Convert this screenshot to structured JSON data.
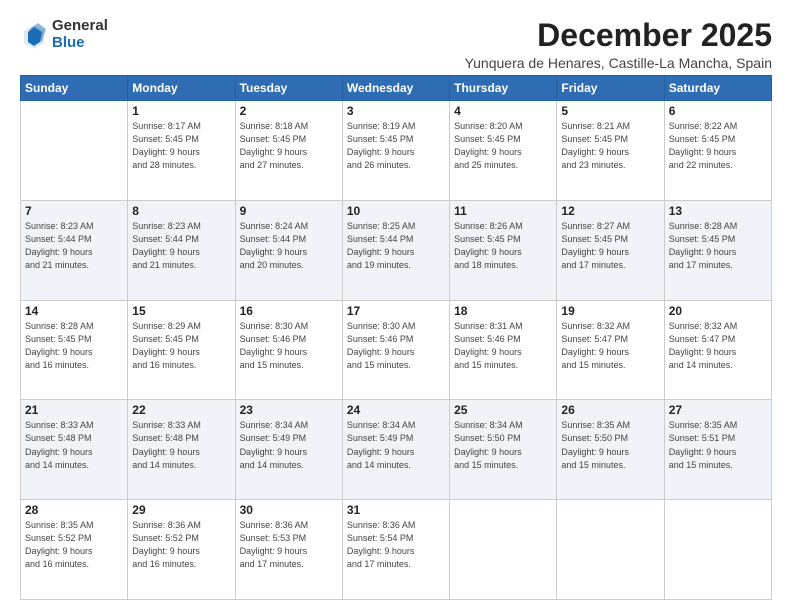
{
  "logo": {
    "general": "General",
    "blue": "Blue"
  },
  "title": "December 2025",
  "location": "Yunquera de Henares, Castille-La Mancha, Spain",
  "days_of_week": [
    "Sunday",
    "Monday",
    "Tuesday",
    "Wednesday",
    "Thursday",
    "Friday",
    "Saturday"
  ],
  "weeks": [
    [
      {
        "day": "",
        "info": ""
      },
      {
        "day": "1",
        "info": "Sunrise: 8:17 AM\nSunset: 5:45 PM\nDaylight: 9 hours\nand 28 minutes."
      },
      {
        "day": "2",
        "info": "Sunrise: 8:18 AM\nSunset: 5:45 PM\nDaylight: 9 hours\nand 27 minutes."
      },
      {
        "day": "3",
        "info": "Sunrise: 8:19 AM\nSunset: 5:45 PM\nDaylight: 9 hours\nand 26 minutes."
      },
      {
        "day": "4",
        "info": "Sunrise: 8:20 AM\nSunset: 5:45 PM\nDaylight: 9 hours\nand 25 minutes."
      },
      {
        "day": "5",
        "info": "Sunrise: 8:21 AM\nSunset: 5:45 PM\nDaylight: 9 hours\nand 23 minutes."
      },
      {
        "day": "6",
        "info": "Sunrise: 8:22 AM\nSunset: 5:45 PM\nDaylight: 9 hours\nand 22 minutes."
      }
    ],
    [
      {
        "day": "7",
        "info": "Sunrise: 8:23 AM\nSunset: 5:44 PM\nDaylight: 9 hours\nand 21 minutes."
      },
      {
        "day": "8",
        "info": "Sunrise: 8:23 AM\nSunset: 5:44 PM\nDaylight: 9 hours\nand 21 minutes."
      },
      {
        "day": "9",
        "info": "Sunrise: 8:24 AM\nSunset: 5:44 PM\nDaylight: 9 hours\nand 20 minutes."
      },
      {
        "day": "10",
        "info": "Sunrise: 8:25 AM\nSunset: 5:44 PM\nDaylight: 9 hours\nand 19 minutes."
      },
      {
        "day": "11",
        "info": "Sunrise: 8:26 AM\nSunset: 5:45 PM\nDaylight: 9 hours\nand 18 minutes."
      },
      {
        "day": "12",
        "info": "Sunrise: 8:27 AM\nSunset: 5:45 PM\nDaylight: 9 hours\nand 17 minutes."
      },
      {
        "day": "13",
        "info": "Sunrise: 8:28 AM\nSunset: 5:45 PM\nDaylight: 9 hours\nand 17 minutes."
      }
    ],
    [
      {
        "day": "14",
        "info": "Sunrise: 8:28 AM\nSunset: 5:45 PM\nDaylight: 9 hours\nand 16 minutes."
      },
      {
        "day": "15",
        "info": "Sunrise: 8:29 AM\nSunset: 5:45 PM\nDaylight: 9 hours\nand 16 minutes."
      },
      {
        "day": "16",
        "info": "Sunrise: 8:30 AM\nSunset: 5:46 PM\nDaylight: 9 hours\nand 15 minutes."
      },
      {
        "day": "17",
        "info": "Sunrise: 8:30 AM\nSunset: 5:46 PM\nDaylight: 9 hours\nand 15 minutes."
      },
      {
        "day": "18",
        "info": "Sunrise: 8:31 AM\nSunset: 5:46 PM\nDaylight: 9 hours\nand 15 minutes."
      },
      {
        "day": "19",
        "info": "Sunrise: 8:32 AM\nSunset: 5:47 PM\nDaylight: 9 hours\nand 15 minutes."
      },
      {
        "day": "20",
        "info": "Sunrise: 8:32 AM\nSunset: 5:47 PM\nDaylight: 9 hours\nand 14 minutes."
      }
    ],
    [
      {
        "day": "21",
        "info": "Sunrise: 8:33 AM\nSunset: 5:48 PM\nDaylight: 9 hours\nand 14 minutes."
      },
      {
        "day": "22",
        "info": "Sunrise: 8:33 AM\nSunset: 5:48 PM\nDaylight: 9 hours\nand 14 minutes."
      },
      {
        "day": "23",
        "info": "Sunrise: 8:34 AM\nSunset: 5:49 PM\nDaylight: 9 hours\nand 14 minutes."
      },
      {
        "day": "24",
        "info": "Sunrise: 8:34 AM\nSunset: 5:49 PM\nDaylight: 9 hours\nand 14 minutes."
      },
      {
        "day": "25",
        "info": "Sunrise: 8:34 AM\nSunset: 5:50 PM\nDaylight: 9 hours\nand 15 minutes."
      },
      {
        "day": "26",
        "info": "Sunrise: 8:35 AM\nSunset: 5:50 PM\nDaylight: 9 hours\nand 15 minutes."
      },
      {
        "day": "27",
        "info": "Sunrise: 8:35 AM\nSunset: 5:51 PM\nDaylight: 9 hours\nand 15 minutes."
      }
    ],
    [
      {
        "day": "28",
        "info": "Sunrise: 8:35 AM\nSunset: 5:52 PM\nDaylight: 9 hours\nand 16 minutes."
      },
      {
        "day": "29",
        "info": "Sunrise: 8:36 AM\nSunset: 5:52 PM\nDaylight: 9 hours\nand 16 minutes."
      },
      {
        "day": "30",
        "info": "Sunrise: 8:36 AM\nSunset: 5:53 PM\nDaylight: 9 hours\nand 17 minutes."
      },
      {
        "day": "31",
        "info": "Sunrise: 8:36 AM\nSunset: 5:54 PM\nDaylight: 9 hours\nand 17 minutes."
      },
      {
        "day": "",
        "info": ""
      },
      {
        "day": "",
        "info": ""
      },
      {
        "day": "",
        "info": ""
      }
    ]
  ]
}
